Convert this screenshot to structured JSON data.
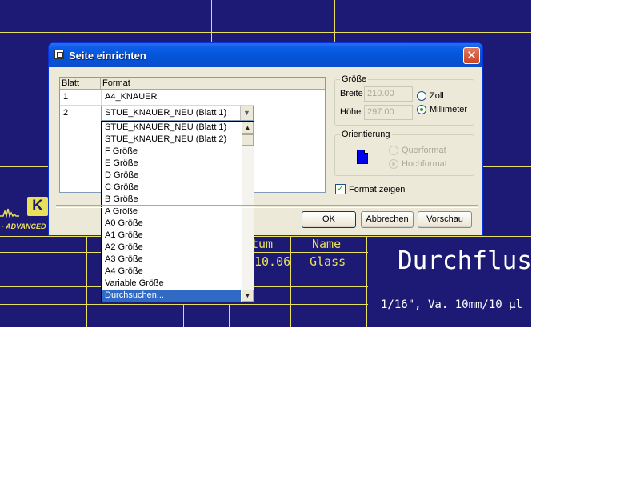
{
  "dialog": {
    "title": "Seite einrichten",
    "close_symbol": "✕",
    "grid": {
      "headers": [
        "Blatt",
        "Format"
      ],
      "rows": [
        {
          "blatt": "1",
          "format": "A4_KNAUER"
        },
        {
          "blatt": "2",
          "format": "STUE_KNAUER_NEU (Blatt 1)"
        }
      ]
    },
    "dropdown_options": [
      "STUE_KNAUER_NEU (Blatt 1)",
      "STUE_KNAUER_NEU (Blatt 2)",
      "F Größe",
      "E Größe",
      "D Größe",
      "C Größe",
      "B Größe",
      "A Größe",
      "A0 Größe",
      "A1 Größe",
      "A2 Größe",
      "A3 Größe",
      "A4 Größe",
      "Variable Größe",
      "Durchsuchen..."
    ],
    "selected_option_index": 14,
    "size_group": {
      "legend": "Größe",
      "width_label": "Breite",
      "width_value": "210.00",
      "height_label": "Höhe",
      "height_value": "297.00",
      "unit_inch": "Zoll",
      "unit_mm": "Millimeter",
      "selected_unit": "Millimeter"
    },
    "orientation_group": {
      "legend": "Orientierung",
      "landscape": "Querformat",
      "portrait": "Hochformat",
      "selected": "Hochformat"
    },
    "show_format": {
      "label": "Format zeigen",
      "checked": true
    },
    "buttons": {
      "ok": "OK",
      "cancel": "Abbrechen",
      "preview": "Vorschau"
    }
  },
  "background": {
    "logo_letter": "K",
    "logo_text": "· ADVANCED",
    "col_datum": "tum",
    "col_name": "Name",
    "date_value": "10.06",
    "name_value": "Glass",
    "title": "Durchfluss",
    "spec": "1/16\", Va. 10mm/10 µl"
  },
  "colors": {
    "cad_background": "#1c1a74",
    "cad_lines": "#e8e05a",
    "selection": "#316ac5",
    "titlebar": "#0453d6"
  }
}
